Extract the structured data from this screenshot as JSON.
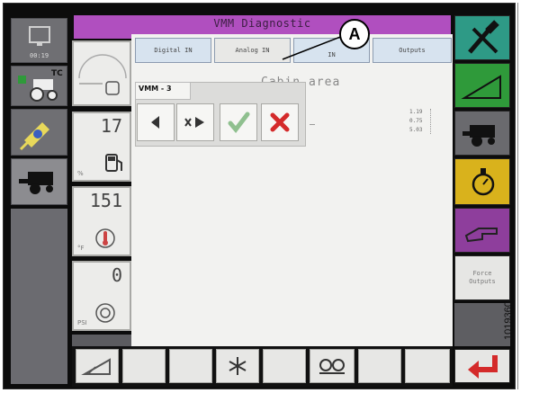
{
  "window": {
    "title": "VMM Diagnostic"
  },
  "tabs": [
    {
      "label": "Digital IN"
    },
    {
      "label": "Analog IN"
    },
    {
      "label": "IN"
    },
    {
      "label": "Outputs"
    }
  ],
  "content": {
    "heading": "Cabin area",
    "values": [
      "1.19",
      "0.75",
      "5.03"
    ]
  },
  "popup": {
    "title": "VMM - 3"
  },
  "callout": {
    "letter": "A"
  },
  "left_panel": {
    "clock_text": "00:19",
    "tc_label": "TC"
  },
  "gauges": [
    {
      "value": "",
      "unit": ""
    },
    {
      "value": "17",
      "unit": "%"
    },
    {
      "value": "151",
      "unit": "°F"
    },
    {
      "value": "0",
      "unit": "PSI"
    }
  ],
  "right_panel": {
    "force_outputs_label": "Force Outputs"
  },
  "figure_id": "1019360",
  "colors": {
    "title_purple": "#b04fbf",
    "tab_blue": "#d7e3ef",
    "green_tile": "#2f9a3a",
    "yellow_tile": "#d9b21c",
    "purple_tile": "#8e3e9c",
    "teal_tile": "#2e9a86",
    "red_arrow": "#d42a2a"
  }
}
